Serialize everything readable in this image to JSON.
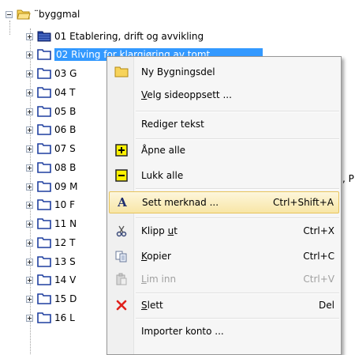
{
  "tree": {
    "root": {
      "label": "¨byggmal"
    },
    "items": [
      {
        "label": "01 Etablering, drift og avvikling",
        "icon": "filled-folder-icon"
      },
      {
        "label": "02 Riving for klargjøring av tomt",
        "icon": "folder-icon",
        "selected": true
      },
      {
        "label": "03 G",
        "icon": "folder-icon"
      },
      {
        "label": "04 T",
        "icon": "folder-icon"
      },
      {
        "label": "05 B",
        "icon": "folder-icon"
      },
      {
        "label": "06 B",
        "icon": "folder-icon"
      },
      {
        "label": "07 S",
        "icon": "folder-icon"
      },
      {
        "label": "08 B",
        "icon": "folder-icon"
      },
      {
        "label": "09 M",
        "icon": "folder-icon"
      },
      {
        "label": "10 F",
        "icon": "folder-icon"
      },
      {
        "label": "11 N",
        "icon": "folder-icon"
      },
      {
        "label": "12 T",
        "icon": "folder-icon"
      },
      {
        "label": "13 S",
        "icon": "folder-icon"
      },
      {
        "label": "14 V",
        "icon": "folder-icon"
      },
      {
        "label": "15 D",
        "icon": "folder-icon"
      },
      {
        "label": "16 L",
        "icon": "folder-icon"
      }
    ],
    "behind_menu_text": ", P"
  },
  "context_menu": {
    "items": [
      {
        "label": "Ny Bygningsdel",
        "shortcut": "",
        "icon": "folder-icon"
      },
      {
        "label_pre": "",
        "label_u": "V",
        "label_post": "elg sideoppsett ...",
        "shortcut": ""
      },
      {
        "label": "Rediger tekst",
        "shortcut": ""
      },
      {
        "label": "Åpne alle",
        "shortcut": "",
        "icon": "expand-all-icon"
      },
      {
        "label": "Lukk alle",
        "shortcut": "",
        "icon": "collapse-all-icon"
      },
      {
        "label": "Sett merknad ...",
        "shortcut": "Ctrl+Shift+A",
        "icon": "annotation-icon",
        "highlighted": true
      },
      {
        "label_pre": "Klipp ",
        "label_u": "u",
        "label_post": "t",
        "shortcut": "Ctrl+X",
        "icon": "scissors-icon"
      },
      {
        "label_pre": "",
        "label_u": "K",
        "label_post": "opier",
        "shortcut": "Ctrl+C",
        "icon": "copy-icon"
      },
      {
        "label_pre": "",
        "label_u": "L",
        "label_post": "im inn",
        "shortcut": "Ctrl+V",
        "icon": "paste-icon",
        "disabled": true
      },
      {
        "label_pre": "",
        "label_u": "S",
        "label_post": "lett",
        "shortcut": "Del",
        "icon": "delete-icon"
      },
      {
        "label": "Importer konto ...",
        "shortcut": ""
      }
    ]
  },
  "colors": {
    "selection": "#3399ff",
    "menu_highlight": "#f8e6a6",
    "delete_red": "#e0201b",
    "folder_blue": "#1f3f9f"
  }
}
